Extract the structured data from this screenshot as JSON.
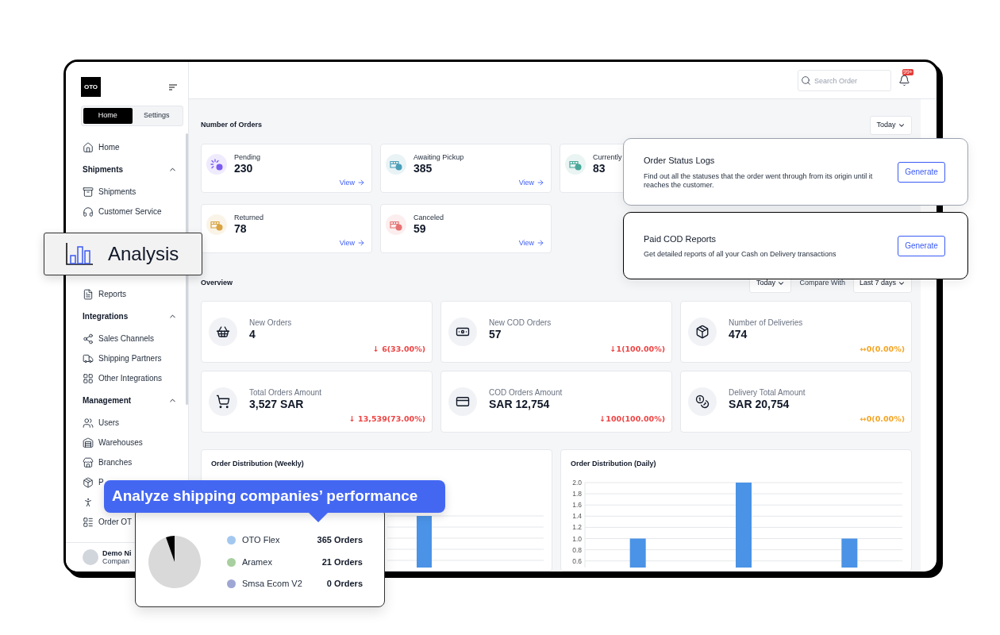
{
  "sidebar": {
    "logo": "OTO",
    "tabs": [
      {
        "label": "Home",
        "selected": true
      },
      {
        "label": "Settings",
        "selected": false
      }
    ],
    "sections": [
      {
        "items": [
          {
            "kind": "link",
            "label": "Home"
          }
        ]
      },
      {
        "title": "Shipments",
        "expanded": true,
        "items": [
          {
            "kind": "link",
            "label": "Shipments"
          },
          {
            "kind": "link",
            "label": "Customer Service"
          }
        ]
      },
      {
        "items": [
          {
            "kind": "link",
            "label": "Reports"
          }
        ]
      },
      {
        "title": "Integrations",
        "expanded": true,
        "items": [
          {
            "kind": "link",
            "label": "Sales Channels"
          },
          {
            "kind": "link",
            "label": "Shipping Partners"
          },
          {
            "kind": "link",
            "label": "Other Integrations"
          }
        ]
      },
      {
        "title": "Management",
        "expanded": true,
        "items": [
          {
            "kind": "link",
            "label": "Users"
          },
          {
            "kind": "link",
            "label": "Warehouses"
          },
          {
            "kind": "link",
            "label": "Branches"
          },
          {
            "kind": "link",
            "label": "P"
          },
          {
            "kind": "icon"
          },
          {
            "kind": "link",
            "label": "Order OT"
          }
        ]
      }
    ],
    "user": {
      "name": "Demo Ni",
      "company": "Compan"
    }
  },
  "topbar": {
    "search": {
      "placeholder": "Search Order"
    },
    "notifications": {
      "badge": "99+"
    }
  },
  "orders": {
    "title": "Number of Orders",
    "period": "Today",
    "cards": [
      {
        "label": "Pending",
        "value": "230",
        "link": "View",
        "color": "#7c5cf0"
      },
      {
        "label": "Awaiting Pickup",
        "value": "385",
        "link": "View",
        "color": "#4a9fb8"
      },
      {
        "label": "Currently",
        "value": "83",
        "color": "#4aa89a"
      },
      {
        "label": "Returned",
        "value": "78",
        "link": "View",
        "color": "#d9a441"
      },
      {
        "label": "Canceled",
        "value": "59",
        "link": "View",
        "color": "#e57373"
      }
    ]
  },
  "overview": {
    "title": "Overview",
    "period": "Today",
    "compare_label": "Compare With",
    "compare_period": "Last 7 days",
    "cards": [
      {
        "label": "New Orders",
        "value": "4",
        "change": "↓ 6(33.00%)",
        "color": "#ef4444"
      },
      {
        "label": "New COD Orders",
        "value": "57",
        "change": "↓1(100.00%)",
        "color": "#ef4444"
      },
      {
        "label": "Number of Deliveries",
        "value": "474",
        "change": "↔0(0.00%)",
        "color": "#f5a524"
      },
      {
        "label": "Total Orders Amount",
        "value": "3,527 SAR",
        "change": "↓ 13,539(73.00%)",
        "color": "#ef4444"
      },
      {
        "label": "COD Orders Amount",
        "value": "SAR 12,754",
        "change": "↓100(100.00%)",
        "color": "#ef4444"
      },
      {
        "label": "Delivery Total Amount",
        "value": "SAR 20,754",
        "change": "↔0(0.00%)",
        "color": "#f5a524"
      }
    ]
  },
  "charts": [
    {
      "title": "Order Distribution (Weekly)"
    },
    {
      "chart_data": {
        "type": "bar",
        "title": "Order Distribution (Daily)",
        "values": [
          1,
          2,
          1
        ],
        "ylim": [
          0.5,
          2
        ],
        "grid": true,
        "yticks": [
          0.6,
          0.8,
          {
            "value": 1,
            "label": "1.0"
          },
          1.2,
          1.4,
          1.6,
          1.8,
          {
            "value": 2,
            "label": "2.0"
          }
        ]
      }
    }
  ],
  "reports": [
    {
      "title": "Order Status Logs",
      "description": "Find out all the statuses that the order went through from its origin until it reaches the customer.",
      "button": "Generate",
      "emphasized": false
    },
    {
      "title": "Paid COD Reports",
      "description": "Get detailed reports of all your Cash on Delivery transactions",
      "button": "Generate",
      "emphasized": true
    }
  ],
  "callout": {
    "label": "Analysis"
  },
  "tooltip": {
    "text": "Analyze shipping companies’ performance"
  },
  "carrier_summary": {
    "chart_data": {
      "type": "pie",
      "categories": [
        "OTO Flex",
        "Aramex",
        "Smsa Ecom V2"
      ],
      "values": [
        94.6,
        5.4,
        0
      ]
    },
    "legend": [
      {
        "count": "365 Orders",
        "color": "#a3c8f0"
      },
      {
        "count": "21 Orders",
        "color": "#a8cf9f"
      },
      {
        "count": "0 Orders",
        "color": "#9ea6d4"
      }
    ]
  }
}
